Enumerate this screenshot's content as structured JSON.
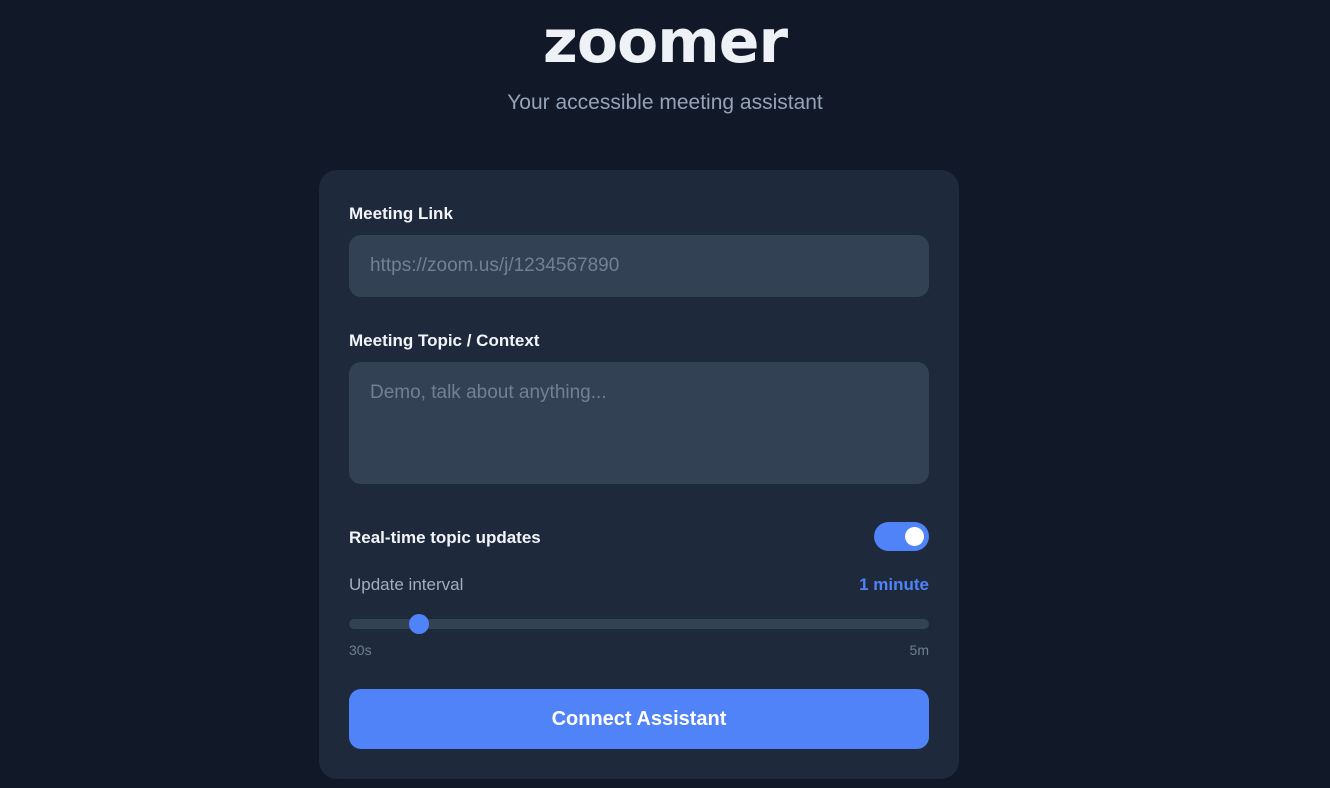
{
  "brand": {
    "logo_text": "zoomer",
    "tagline": "Your accessible meeting assistant"
  },
  "form": {
    "meeting_link": {
      "label": "Meeting Link",
      "value": "",
      "placeholder": "https://zoom.us/j/1234567890"
    },
    "topic": {
      "label": "Meeting Topic / Context",
      "value": "",
      "placeholder": "Demo, talk about anything..."
    },
    "realtime_updates": {
      "label": "Real-time topic updates",
      "enabled": true
    },
    "update_interval": {
      "label": "Update interval",
      "value_text": "1 minute",
      "slider_fraction": 0.12,
      "min_label": "30s",
      "max_label": "5m"
    },
    "connect_label": "Connect Assistant"
  },
  "colors": {
    "background": "#111827",
    "card": "#1e293b",
    "input": "#334155",
    "accent": "#4f83f7"
  }
}
